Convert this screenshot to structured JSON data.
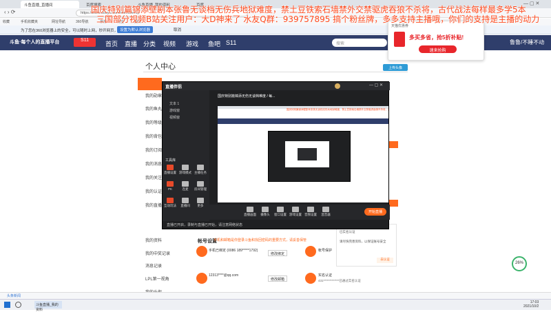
{
  "browser": {
    "tabs": [
      "斗鱼直播_直播间",
      "百度搜索",
      "斗鱼直播_我的资料",
      "百度"
    ],
    "url": "https://www.douyu.com/member/cp",
    "bookmarks": [
      "收藏",
      "手机收藏夹",
      "网址导航",
      "360导航",
      "京东",
      "淘宝",
      "翻译"
    ],
    "notice": "为了您在360浏览器上的安全，可以随时上网，秒开网页，是否设为默认",
    "notice_btn": "设置为默认浏览器",
    "notice_cancel": "取消"
  },
  "overlay": {
    "line1": "国庆特别篇锦添壁剧本张鲁无谈档无伤兵地狱难度，禁土豆铁索石墙禁外交禁驱虎吞狼不杀将，古代战法每样最多学5本",
    "line2": "三国部分视频B站关注用户：大D神来了  水友Q群：939757895  搞个粉丝牌，多多支持主播哦，你们的支持是主播的动力"
  },
  "site": {
    "logo": "斗鱼·每个人的直播平台",
    "nav": [
      "首页",
      "直播",
      "分类",
      "视频",
      "游戏",
      "鱼吧",
      "S11"
    ],
    "search_placeholder": "搜索",
    "right_btn": "鲁鲁/不睡不动"
  },
  "ad": {
    "title": "天猫优惠券",
    "headline": "多买多省，抢5折补贴!",
    "cta": "速来抢购"
  },
  "page": {
    "heading": "个人中心",
    "upload_btn": "上传头像",
    "menu": [
      "我的资料",
      "我的勋章",
      "我的鱼丸",
      "我的等级",
      "我的背包",
      "我的订阅",
      "我的消息",
      "我的关注",
      "我的认证",
      "我的直播",
      "我的中奖记录",
      "消息记录",
      "LPL第一视角",
      "我的头衔"
    ],
    "account": {
      "title": "帐号设置",
      "mobile_label": "手机已绑定",
      "mobile_value": "(0086 189*****1792)",
      "mobile_btn": "修改绑定",
      "email_value": "12313****@qq.com",
      "email_btn": "修改邮箱",
      "realname": "实名认证",
      "realname_value": "431*************已通过实名认证",
      "protect": "帐号保护",
      "tip_btn": "去认证"
    },
    "tip_text": "手机和邮箱是你登录斗鱼和找回密码的重要方式，请妥善保管"
  },
  "obs": {
    "app_name": "直播伴侣",
    "room_title": "国庆特别篇锦添无伤无谈档难度 / 每...",
    "scenes": [
      "文本 1",
      "游戏窗",
      "视频窗"
    ],
    "tools_title": "工具库",
    "tools": [
      "直播设置",
      "游戏模式",
      "主播任务",
      "PK",
      "连麦",
      "房间管理",
      "互动玩法",
      "直播间",
      "更多"
    ],
    "bottom": [
      "直播画面",
      "摄像头",
      "窗口设置",
      "游戏设置",
      "音频设置",
      "混音器"
    ],
    "start_btn": "开始直播",
    "status": "直播已开启，录制与直播已开始，请注意网络状态"
  },
  "side_info": {
    "text1": "已实名认证",
    "text2": "请尽快完善资料，以保证账号安全"
  },
  "badge": "26%",
  "taskbar": {
    "status_text": "头条新闻",
    "time": "17:03",
    "date": "2021/10/2"
  },
  "colors": {
    "accent": "#ff6a1e",
    "nav": "#2f3e6b",
    "overlay": "#ff4b1f"
  }
}
